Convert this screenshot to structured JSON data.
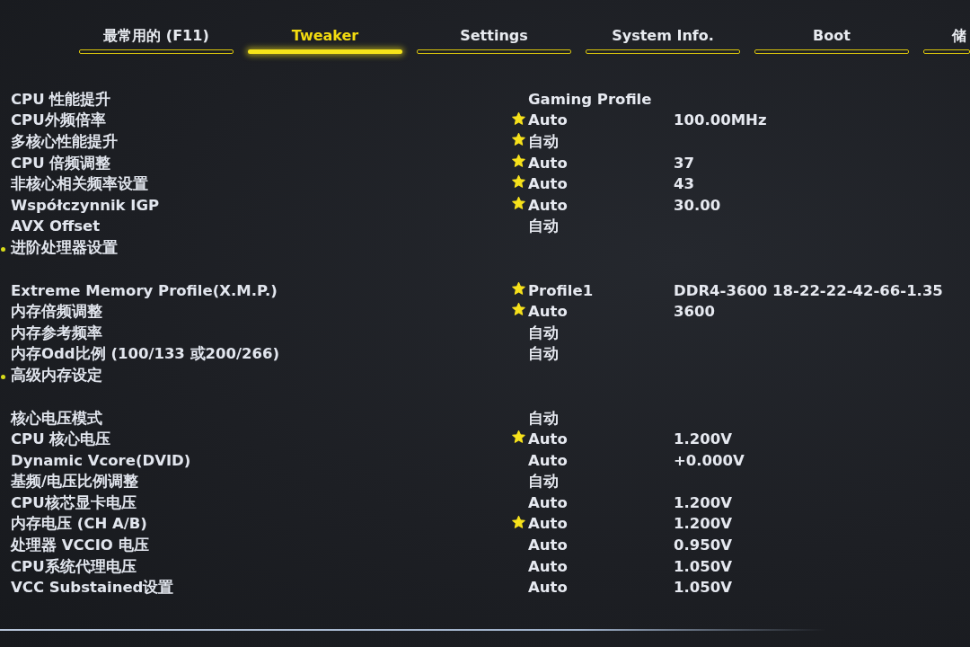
{
  "tabs": [
    {
      "label": "最常用的 (F11)",
      "selected": false
    },
    {
      "label": "Tweaker",
      "selected": true
    },
    {
      "label": "Settings",
      "selected": false
    },
    {
      "label": "System Info.",
      "selected": false
    },
    {
      "label": "Boot",
      "selected": false
    },
    {
      "label": "储",
      "selected": false
    }
  ],
  "sections": [
    {
      "rows": [
        {
          "kind": "setting",
          "label": "CPU 性能提升",
          "starred": false,
          "value": "Gaming Profile"
        },
        {
          "kind": "setting",
          "label": "CPU外频倍率",
          "starred": true,
          "value": "Auto",
          "reading": "100.00MHz"
        },
        {
          "kind": "setting",
          "label": "多核心性能提升",
          "starred": true,
          "value": "自动"
        },
        {
          "kind": "setting",
          "label": "CPU 倍频调整",
          "starred": true,
          "value": "Auto",
          "reading": "37"
        },
        {
          "kind": "setting",
          "label": "非核心相关频率设置",
          "starred": true,
          "value": "Auto",
          "reading": "43"
        },
        {
          "kind": "setting",
          "label": "Współczynnik IGP",
          "starred": true,
          "value": "Auto",
          "reading": "30.00"
        },
        {
          "kind": "setting",
          "label": "AVX Offset",
          "starred": false,
          "value": "自动"
        },
        {
          "kind": "submenu",
          "label": "进阶处理器设置"
        }
      ]
    },
    {
      "rows": [
        {
          "kind": "setting",
          "label": "Extreme Memory Profile(X.M.P.)",
          "starred": true,
          "value": "Profile1",
          "reading": "DDR4-3600 18-22-22-42-66-1.35"
        },
        {
          "kind": "setting",
          "label": "内存倍频调整",
          "starred": true,
          "value": "Auto",
          "reading": "3600"
        },
        {
          "kind": "setting",
          "label": "内存参考频率",
          "starred": false,
          "value": "自动"
        },
        {
          "kind": "setting",
          "label": "内存Odd比例 (100/133 或200/266)",
          "starred": false,
          "value": "自动"
        },
        {
          "kind": "submenu",
          "label": "高级内存设定"
        }
      ]
    },
    {
      "rows": [
        {
          "kind": "setting",
          "label": "核心电压模式",
          "starred": false,
          "value": "自动"
        },
        {
          "kind": "setting",
          "label": "CPU 核心电压",
          "starred": true,
          "value": "Auto",
          "reading": "1.200V"
        },
        {
          "kind": "setting",
          "label": "Dynamic Vcore(DVID)",
          "starred": false,
          "value": "Auto",
          "reading": "+0.000V"
        },
        {
          "kind": "setting",
          "label": "基频/电压比例调整",
          "starred": false,
          "value": "自动"
        },
        {
          "kind": "setting",
          "label": "CPU核芯显卡电压",
          "starred": false,
          "value": "Auto",
          "reading": "1.200V"
        },
        {
          "kind": "setting",
          "label": "内存电压 (CH A/B)",
          "starred": true,
          "value": "Auto",
          "reading": "1.200V"
        },
        {
          "kind": "setting",
          "label": "处理器 VCCIO 电压",
          "starred": false,
          "value": "Auto",
          "reading": "0.950V"
        },
        {
          "kind": "setting",
          "label": "CPU系统代理电压",
          "starred": false,
          "value": "Auto",
          "reading": "1.050V"
        },
        {
          "kind": "setting",
          "label": "VCC Substained设置",
          "starred": false,
          "value": "Auto",
          "reading": "1.050V"
        }
      ]
    }
  ]
}
